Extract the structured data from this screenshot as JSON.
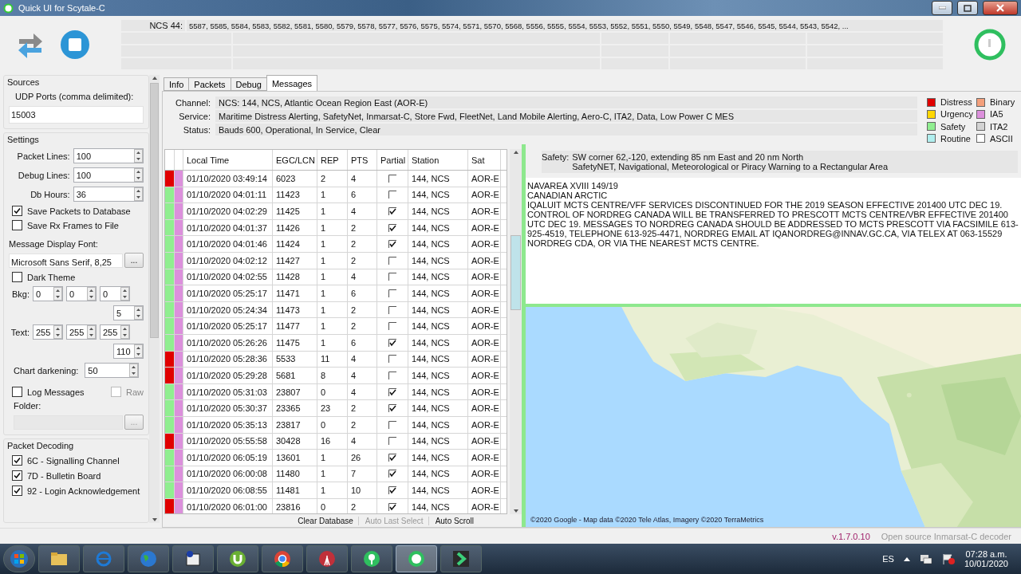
{
  "window": {
    "title": "Quick UI for Scytale-C"
  },
  "toolbar": {
    "ncs_label": "NCS 44:",
    "ncs_list": "5587, 5585, 5584, 5583, 5582, 5581, 5580, 5579, 5578, 5577, 5576, 5575, 5574, 5571, 5570, 5568, 5556, 5555, 5554, 5553, 5552, 5551, 5550, 5549, 5548, 5547, 5546, 5545, 5544, 5543, 5542, ..."
  },
  "sidebar": {
    "sources": {
      "title": "Sources",
      "udp_label": "UDP Ports (comma delimited):",
      "udp_value": "15003"
    },
    "settings": {
      "title": "Settings",
      "spins": [
        {
          "label": "Packet Lines:",
          "value": "100"
        },
        {
          "label": "Debug Lines:",
          "value": "100"
        },
        {
          "label": "Db Hours:",
          "value": "36"
        }
      ],
      "checks": [
        {
          "label": "Save Packets to Database",
          "checked": true
        },
        {
          "label": "Save Rx Frames to File",
          "checked": false
        }
      ],
      "font_label": "Message Display Font:",
      "font_value": "Microsoft Sans Serif, 8,25",
      "font_button": "...",
      "dark_theme": {
        "label": "Dark Theme",
        "checked": false
      },
      "bkg": {
        "label": "Bkg:",
        "values": [
          "0",
          "0",
          "0",
          "5"
        ]
      },
      "text": {
        "label": "Text:",
        "values": [
          "255",
          "255",
          "255",
          "110"
        ]
      },
      "chart_darkening": {
        "label": "Chart darkening:",
        "value": "50"
      },
      "log_messages": {
        "label": "Log Messages",
        "checked": false
      },
      "raw": {
        "label": "Raw",
        "checked": false,
        "disabled": true
      },
      "folder_label": "Folder:",
      "folder_button": "..."
    },
    "decoding": {
      "title": "Packet Decoding",
      "items": [
        {
          "label": "6C - Signalling Channel",
          "checked": true
        },
        {
          "label": "7D - Bulletin Board",
          "checked": true
        },
        {
          "label": "92 - Login Acknowledgement",
          "checked": true
        }
      ]
    }
  },
  "tabs": [
    {
      "label": "Info",
      "selected": false
    },
    {
      "label": "Packets",
      "selected": false
    },
    {
      "label": "Debug",
      "selected": false
    },
    {
      "label": "Messages",
      "selected": true
    }
  ],
  "info": [
    {
      "label": "Channel:",
      "value": "NCS: 144, NCS, Atlantic Ocean Region East (AOR-E)"
    },
    {
      "label": "Service:",
      "value": "Maritime Distress Alerting, SafetyNet, Inmarsat-C, Store Fwd, FleetNet, Land Mobile Alerting, Aero-C, ITA2, Data, Low Power C MES"
    },
    {
      "label": "Status:",
      "value": "Bauds 600, Operational, In Service, Clear"
    }
  ],
  "legend": [
    {
      "label": "Distress",
      "color": "#e00000"
    },
    {
      "label": "Binary",
      "color": "#f4a07c"
    },
    {
      "label": "Urgency",
      "color": "#ffd700"
    },
    {
      "label": "IA5",
      "color": "#dc90dc"
    },
    {
      "label": "Safety",
      "color": "#90ee90"
    },
    {
      "label": "ITA2",
      "color": "#d3d3d3"
    },
    {
      "label": "Routine",
      "color": "#b0eeee"
    },
    {
      "label": "ASCII",
      "color": "#ffffff"
    }
  ],
  "row_type_marker": {
    "color": "#dc90dc"
  },
  "table": {
    "columns": [
      "Local Time",
      "EGC/LCN",
      "REP",
      "PTS",
      "Partial",
      "Station",
      "Sat"
    ],
    "rows": [
      {
        "color": "#e00000",
        "time": "01/10/2020 03:49:14",
        "egc": "6023",
        "rep": "2",
        "pts": "4",
        "partial": false,
        "station": "144, NCS",
        "sat": "AOR-E"
      },
      {
        "color": "#90ee90",
        "time": "01/10/2020 04:01:11",
        "egc": "11423",
        "rep": "1",
        "pts": "6",
        "partial": false,
        "station": "144, NCS",
        "sat": "AOR-E"
      },
      {
        "color": "#90ee90",
        "time": "01/10/2020 04:02:29",
        "egc": "11425",
        "rep": "1",
        "pts": "4",
        "partial": true,
        "station": "144, NCS",
        "sat": "AOR-E"
      },
      {
        "color": "#90ee90",
        "time": "01/10/2020 04:01:37",
        "egc": "11426",
        "rep": "1",
        "pts": "2",
        "partial": true,
        "station": "144, NCS",
        "sat": "AOR-E"
      },
      {
        "color": "#90ee90",
        "time": "01/10/2020 04:01:46",
        "egc": "11424",
        "rep": "1",
        "pts": "2",
        "partial": true,
        "station": "144, NCS",
        "sat": "AOR-E"
      },
      {
        "color": "#90ee90",
        "time": "01/10/2020 04:02:12",
        "egc": "11427",
        "rep": "1",
        "pts": "2",
        "partial": false,
        "station": "144, NCS",
        "sat": "AOR-E"
      },
      {
        "color": "#90ee90",
        "time": "01/10/2020 04:02:55",
        "egc": "11428",
        "rep": "1",
        "pts": "4",
        "partial": false,
        "station": "144, NCS",
        "sat": "AOR-E"
      },
      {
        "color": "#90ee90",
        "time": "01/10/2020 05:25:17",
        "egc": "11471",
        "rep": "1",
        "pts": "6",
        "partial": false,
        "station": "144, NCS",
        "sat": "AOR-E"
      },
      {
        "color": "#90ee90",
        "time": "01/10/2020 05:24:34",
        "egc": "11473",
        "rep": "1",
        "pts": "2",
        "partial": false,
        "station": "144, NCS",
        "sat": "AOR-E"
      },
      {
        "color": "#90ee90",
        "time": "01/10/2020 05:25:17",
        "egc": "11477",
        "rep": "1",
        "pts": "2",
        "partial": false,
        "station": "144, NCS",
        "sat": "AOR-E"
      },
      {
        "color": "#90ee90",
        "time": "01/10/2020 05:26:26",
        "egc": "11475",
        "rep": "1",
        "pts": "6",
        "partial": true,
        "station": "144, NCS",
        "sat": "AOR-E"
      },
      {
        "color": "#e00000",
        "time": "01/10/2020 05:28:36",
        "egc": "5533",
        "rep": "11",
        "pts": "4",
        "partial": false,
        "station": "144, NCS",
        "sat": "AOR-E"
      },
      {
        "color": "#e00000",
        "time": "01/10/2020 05:29:28",
        "egc": "5681",
        "rep": "8",
        "pts": "4",
        "partial": false,
        "station": "144, NCS",
        "sat": "AOR-E"
      },
      {
        "color": "#90ee90",
        "time": "01/10/2020 05:31:03",
        "egc": "23807",
        "rep": "0",
        "pts": "4",
        "partial": true,
        "station": "144, NCS",
        "sat": "AOR-E"
      },
      {
        "color": "#90ee90",
        "time": "01/10/2020 05:30:37",
        "egc": "23365",
        "rep": "23",
        "pts": "2",
        "partial": true,
        "station": "144, NCS",
        "sat": "AOR-E"
      },
      {
        "color": "#90ee90",
        "time": "01/10/2020 05:35:13",
        "egc": "23817",
        "rep": "0",
        "pts": "2",
        "partial": false,
        "station": "144, NCS",
        "sat": "AOR-E"
      },
      {
        "color": "#e00000",
        "time": "01/10/2020 05:55:58",
        "egc": "30428",
        "rep": "16",
        "pts": "4",
        "partial": false,
        "station": "144, NCS",
        "sat": "AOR-E"
      },
      {
        "color": "#90ee90",
        "time": "01/10/2020 06:05:19",
        "egc": "13601",
        "rep": "1",
        "pts": "26",
        "partial": true,
        "station": "144, NCS",
        "sat": "AOR-E"
      },
      {
        "color": "#90ee90",
        "time": "01/10/2020 06:00:08",
        "egc": "11480",
        "rep": "1",
        "pts": "7",
        "partial": true,
        "station": "144, NCS",
        "sat": "AOR-E"
      },
      {
        "color": "#90ee90",
        "time": "01/10/2020 06:08:55",
        "egc": "11481",
        "rep": "1",
        "pts": "10",
        "partial": true,
        "station": "144, NCS",
        "sat": "AOR-E"
      },
      {
        "color": "#e00000",
        "time": "01/10/2020 06:01:00",
        "egc": "23816",
        "rep": "0",
        "pts": "2",
        "partial": true,
        "station": "144, NCS",
        "sat": "AOR-E"
      }
    ]
  },
  "actions": [
    {
      "label": "Clear Database",
      "disabled": false
    },
    {
      "label": "Auto Last Select",
      "disabled": true
    },
    {
      "label": "Auto Scroll",
      "disabled": false
    }
  ],
  "message": {
    "header_label": "Safety:",
    "header_lines": [
      "SW corner 62,-120, extending 85 nm East and 20 nm North",
      "SafetyNET, Navigational, Meteorological or Piracy Warning to a Rectangular Area"
    ],
    "body": [
      "NAVAREA XVIII 149/19",
      "CANADIAN ARCTIC",
      "IQALUIT MCTS CENTRE/VFF SERVICES DISCONTINUED FOR THE 2019 SEASON EFFECTIVE 201400 UTC DEC 19. CONTROL OF NORDREG CANADA WILL BE TRANSFERRED TO PRESCOTT MCTS CENTRE/VBR EFFECTIVE 201400 UTC DEC 19. MESSAGES TO NORDREG CANADA SHOULD BE ADDRESSED TO MCTS PRESCOTT VIA FACSIMILE 613-925-4519, TELEPHONE 613-925-4471, NORDREG EMAIL AT IQANORDREG@INNAV.GC.CA, VIA TELEX AT 063-15529 NORDREG CDA, OR VIA THE NEAREST MCTS CENTRE."
    ]
  },
  "map": {
    "kind": "picture",
    "attribution": "©2020 Google - Map data ©2020 Tele Atlas, Imagery ©2020 TerraMetrics"
  },
  "status_bar": {
    "version": "v.1.7.0.10",
    "description": "Open source Inmarsat-C decoder"
  },
  "taskbar": {
    "language": "ES",
    "time": "07:28 a.m.",
    "date": "10/01/2020"
  }
}
